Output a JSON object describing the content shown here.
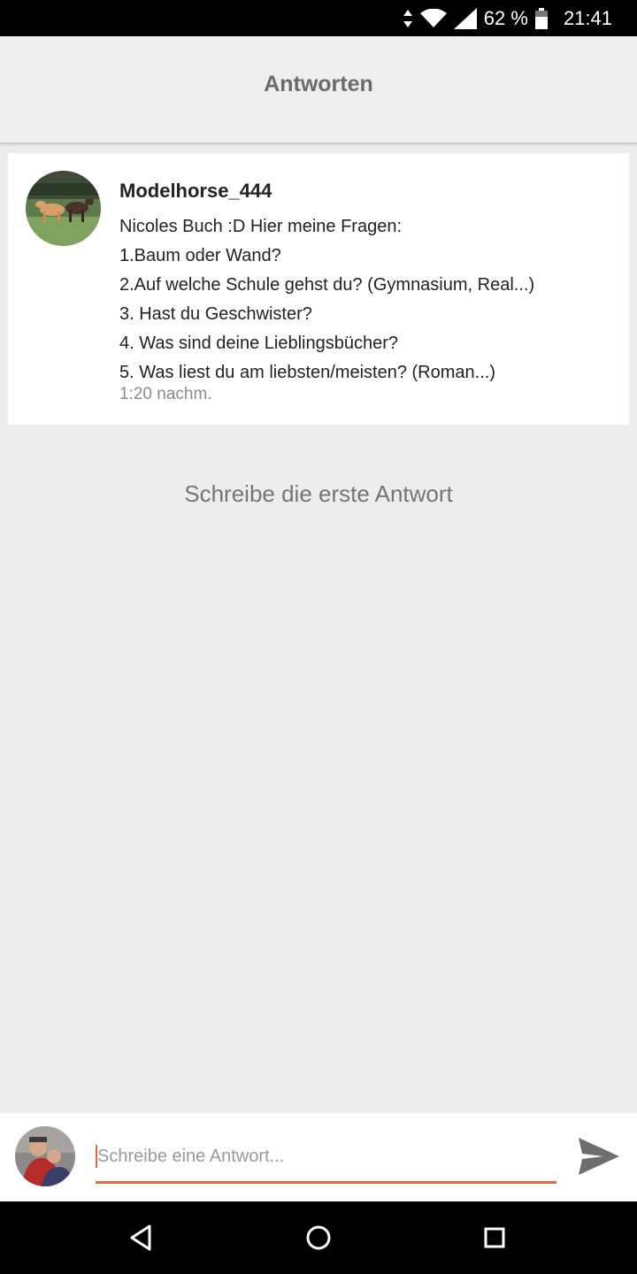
{
  "status_bar": {
    "battery": "62 %",
    "time": "21:41",
    "icons": [
      "data-arrows-icon",
      "wifi-icon",
      "signal-icon",
      "battery-icon"
    ]
  },
  "header": {
    "title": "Antworten"
  },
  "post": {
    "username": "Modelhorse_444",
    "lines": [
      "Nicoles Buch :D  Hier meine Fragen:",
      "1.Baum oder Wand?",
      "2.Auf welche Schule gehst du? (Gymnasium, Real...)",
      "3. Hast du Geschwister?",
      "4. Was sind deine Lieblingsbücher?",
      "5. Was liest du am liebsten/meisten? (Roman...)"
    ],
    "time": "1:20 nachm."
  },
  "empty_state": {
    "text": "Schreibe die erste Antwort"
  },
  "reply": {
    "placeholder": "Schreibe eine Antwort...",
    "value": ""
  },
  "colors": {
    "accent": "#e8673a",
    "background": "#ededed",
    "card": "#ffffff"
  },
  "nav": {
    "icons": [
      "back-icon",
      "home-icon",
      "recents-icon"
    ]
  }
}
